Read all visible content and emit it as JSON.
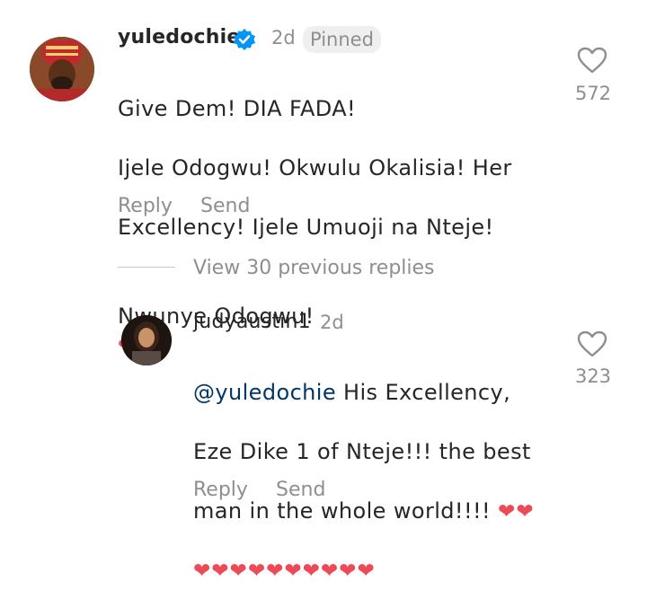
{
  "comment": {
    "username": "yuledochie",
    "age": "2d",
    "pinned_label": "Pinned",
    "text_lines": [
      "Give Dem! DIA FADA!",
      "Ijele Odogwu! Okwulu Okalisia! Her",
      "Excellency! Ijele Umuoji na Nteje!",
      "Nwunye Odogwu!"
    ],
    "emoji_end": "❤❤❤",
    "reply_label": "Reply",
    "send_label": "Send",
    "like_count": "572"
  },
  "view_replies_label": "View 30 previous replies",
  "reply": {
    "username": "judyaustin1",
    "age": "2d",
    "mention": "@yuledochie",
    "line1_rest": " His Excellency,",
    "line2": "Eze Dike 1 of Nteje!!! the best",
    "line3": "man in the whole world!!!!",
    "line3_hearts": "❤❤",
    "line4_hearts": "❤❤❤❤❤❤❤❤❤❤",
    "reply_label": "Reply",
    "send_label": "Send",
    "like_count": "323"
  },
  "colors": {
    "heart": "#ed4956",
    "verified": "#0095f6",
    "mention": "#00376b"
  }
}
